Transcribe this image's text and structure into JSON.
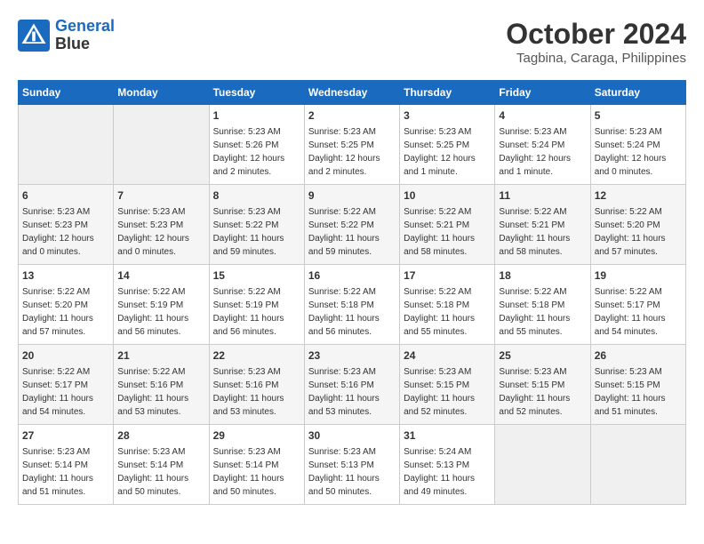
{
  "header": {
    "logo_line1": "General",
    "logo_line2": "Blue",
    "month": "October 2024",
    "location": "Tagbina, Caraga, Philippines"
  },
  "days_of_week": [
    "Sunday",
    "Monday",
    "Tuesday",
    "Wednesday",
    "Thursday",
    "Friday",
    "Saturday"
  ],
  "weeks": [
    [
      {
        "day": "",
        "info": ""
      },
      {
        "day": "",
        "info": ""
      },
      {
        "day": "1",
        "info": "Sunrise: 5:23 AM\nSunset: 5:26 PM\nDaylight: 12 hours and 2 minutes."
      },
      {
        "day": "2",
        "info": "Sunrise: 5:23 AM\nSunset: 5:25 PM\nDaylight: 12 hours and 2 minutes."
      },
      {
        "day": "3",
        "info": "Sunrise: 5:23 AM\nSunset: 5:25 PM\nDaylight: 12 hours and 1 minute."
      },
      {
        "day": "4",
        "info": "Sunrise: 5:23 AM\nSunset: 5:24 PM\nDaylight: 12 hours and 1 minute."
      },
      {
        "day": "5",
        "info": "Sunrise: 5:23 AM\nSunset: 5:24 PM\nDaylight: 12 hours and 0 minutes."
      }
    ],
    [
      {
        "day": "6",
        "info": "Sunrise: 5:23 AM\nSunset: 5:23 PM\nDaylight: 12 hours and 0 minutes."
      },
      {
        "day": "7",
        "info": "Sunrise: 5:23 AM\nSunset: 5:23 PM\nDaylight: 12 hours and 0 minutes."
      },
      {
        "day": "8",
        "info": "Sunrise: 5:23 AM\nSunset: 5:22 PM\nDaylight: 11 hours and 59 minutes."
      },
      {
        "day": "9",
        "info": "Sunrise: 5:22 AM\nSunset: 5:22 PM\nDaylight: 11 hours and 59 minutes."
      },
      {
        "day": "10",
        "info": "Sunrise: 5:22 AM\nSunset: 5:21 PM\nDaylight: 11 hours and 58 minutes."
      },
      {
        "day": "11",
        "info": "Sunrise: 5:22 AM\nSunset: 5:21 PM\nDaylight: 11 hours and 58 minutes."
      },
      {
        "day": "12",
        "info": "Sunrise: 5:22 AM\nSunset: 5:20 PM\nDaylight: 11 hours and 57 minutes."
      }
    ],
    [
      {
        "day": "13",
        "info": "Sunrise: 5:22 AM\nSunset: 5:20 PM\nDaylight: 11 hours and 57 minutes."
      },
      {
        "day": "14",
        "info": "Sunrise: 5:22 AM\nSunset: 5:19 PM\nDaylight: 11 hours and 56 minutes."
      },
      {
        "day": "15",
        "info": "Sunrise: 5:22 AM\nSunset: 5:19 PM\nDaylight: 11 hours and 56 minutes."
      },
      {
        "day": "16",
        "info": "Sunrise: 5:22 AM\nSunset: 5:18 PM\nDaylight: 11 hours and 56 minutes."
      },
      {
        "day": "17",
        "info": "Sunrise: 5:22 AM\nSunset: 5:18 PM\nDaylight: 11 hours and 55 minutes."
      },
      {
        "day": "18",
        "info": "Sunrise: 5:22 AM\nSunset: 5:18 PM\nDaylight: 11 hours and 55 minutes."
      },
      {
        "day": "19",
        "info": "Sunrise: 5:22 AM\nSunset: 5:17 PM\nDaylight: 11 hours and 54 minutes."
      }
    ],
    [
      {
        "day": "20",
        "info": "Sunrise: 5:22 AM\nSunset: 5:17 PM\nDaylight: 11 hours and 54 minutes."
      },
      {
        "day": "21",
        "info": "Sunrise: 5:22 AM\nSunset: 5:16 PM\nDaylight: 11 hours and 53 minutes."
      },
      {
        "day": "22",
        "info": "Sunrise: 5:23 AM\nSunset: 5:16 PM\nDaylight: 11 hours and 53 minutes."
      },
      {
        "day": "23",
        "info": "Sunrise: 5:23 AM\nSunset: 5:16 PM\nDaylight: 11 hours and 53 minutes."
      },
      {
        "day": "24",
        "info": "Sunrise: 5:23 AM\nSunset: 5:15 PM\nDaylight: 11 hours and 52 minutes."
      },
      {
        "day": "25",
        "info": "Sunrise: 5:23 AM\nSunset: 5:15 PM\nDaylight: 11 hours and 52 minutes."
      },
      {
        "day": "26",
        "info": "Sunrise: 5:23 AM\nSunset: 5:15 PM\nDaylight: 11 hours and 51 minutes."
      }
    ],
    [
      {
        "day": "27",
        "info": "Sunrise: 5:23 AM\nSunset: 5:14 PM\nDaylight: 11 hours and 51 minutes."
      },
      {
        "day": "28",
        "info": "Sunrise: 5:23 AM\nSunset: 5:14 PM\nDaylight: 11 hours and 50 minutes."
      },
      {
        "day": "29",
        "info": "Sunrise: 5:23 AM\nSunset: 5:14 PM\nDaylight: 11 hours and 50 minutes."
      },
      {
        "day": "30",
        "info": "Sunrise: 5:23 AM\nSunset: 5:13 PM\nDaylight: 11 hours and 50 minutes."
      },
      {
        "day": "31",
        "info": "Sunrise: 5:24 AM\nSunset: 5:13 PM\nDaylight: 11 hours and 49 minutes."
      },
      {
        "day": "",
        "info": ""
      },
      {
        "day": "",
        "info": ""
      }
    ]
  ]
}
